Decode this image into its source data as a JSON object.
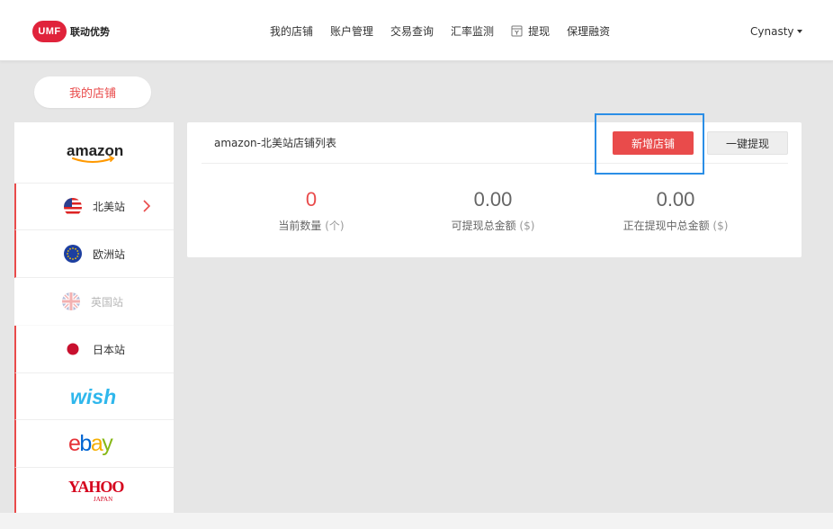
{
  "header": {
    "logo_badge": "UMF",
    "logo_text": "联动优势",
    "nav": [
      {
        "label": "我的店铺"
      },
      {
        "label": "账户管理"
      },
      {
        "label": "交易查询"
      },
      {
        "label": "汇率监测"
      },
      {
        "label": "提现",
        "icon": "withdraw-icon"
      },
      {
        "label": "保理融资"
      }
    ],
    "user_name": "Cynasty"
  },
  "my_store_pill": "我的店铺",
  "sidebar": {
    "platforms": [
      {
        "name": "amazon",
        "type": "logo"
      },
      {
        "label": "北美站",
        "flag": "us-flag-icon",
        "active": true
      },
      {
        "label": "欧洲站",
        "flag": "eu-flag-icon"
      },
      {
        "label": "英国站",
        "flag": "uk-flag-icon",
        "disabled": true
      },
      {
        "label": "日本站",
        "flag": "jp-flag-icon"
      },
      {
        "name": "wish",
        "type": "logo"
      },
      {
        "name": "ebay",
        "type": "logo"
      },
      {
        "name": "YAHOO!",
        "sub": "JAPAN",
        "type": "logo"
      }
    ]
  },
  "card": {
    "title": "amazon-北美站店铺列表",
    "add_button": "新增店铺",
    "withdraw_button": "一键提现",
    "stats": [
      {
        "value": "0",
        "caption": "当前数量",
        "unit": "(个)"
      },
      {
        "value": "0.00",
        "caption": "可提现总金额",
        "unit": "($)"
      },
      {
        "value": "0.00",
        "caption": "正在提现中总金额",
        "unit": "($)"
      }
    ]
  },
  "colors": {
    "accent": "#e94b4b",
    "highlight": "#2b8ee6",
    "background": "#e6e6e6"
  }
}
